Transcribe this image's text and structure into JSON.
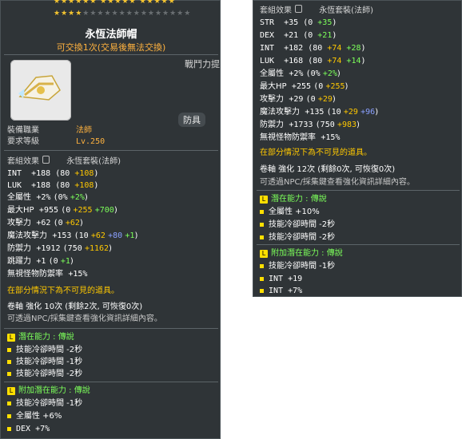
{
  "left": {
    "stars_top": "★★★★★★ ★★★★★ ★★★★★",
    "stars_row_on": "★★★★",
    "stars_row_off": "★★★★★★★★★★★★★★★",
    "item_name": "永恆法師帽",
    "trade_note": "可交換1次(交易後無法交換)",
    "side_label": "戰鬥力提",
    "tab_armor": "防具",
    "equip_job_label": "裝備職業",
    "equip_job_value": "法師",
    "req_level_label": "要求等級",
    "req_level_value": "Lv.250",
    "set_label": "套組效果",
    "set_name": "永恆套裝(法師)",
    "stats": {
      "int": {
        "label": "INT",
        "total": "+188",
        "base": "(80",
        "bonus": "+108",
        "end": ")"
      },
      "luk": {
        "label": "LUK",
        "total": "+188",
        "base": "(80",
        "bonus": "+108",
        "end": ")"
      },
      "all": {
        "label": "全屬性",
        "total": "+2%",
        "base": "(0%",
        "bonus": "+2%",
        "end": ")"
      },
      "hp": {
        "label": "最大HP",
        "total": "+955",
        "base": "(0",
        "b1": "+255",
        "b2": "+700",
        "end": ")"
      },
      "atk": {
        "label": "攻擊力",
        "total": "+62",
        "base": "(0",
        "bonus": "+62",
        "end": ")"
      },
      "matk": {
        "label": "魔法攻擊力",
        "total": "+153",
        "base": "(10",
        "b1": "+62",
        "b2": "+80",
        "b3": "+1",
        "end": ")"
      },
      "def": {
        "label": "防禦力",
        "total": "+1912",
        "base": "(750",
        "bonus": "+1162",
        "end": ")"
      },
      "jump": {
        "label": "跳躍力",
        "total": "+1",
        "base": "(0",
        "bonus": "+1",
        "end": ")"
      },
      "ied": {
        "label": "無視怪物防禦率",
        "total": "+15%"
      }
    },
    "partial_note": "在部分情況下為不可見的道具。",
    "scroll_line": "卷軸 強化 10次 (剩餘2次, 可恢復0次)",
    "npc_note": "可透過NPC/採集鍵查看強化資訊詳細內容。",
    "potential_label": "潛在能力 : 傳說",
    "potential": [
      "技能冷卻時間 -2秒",
      "技能冷卻時間 -1秒",
      "技能冷卻時間 -2秒"
    ],
    "add_potential_label": "附加潛在能力 : 傳說",
    "add_potential": [
      "技能冷卻時間 -1秒",
      "全屬性 +6%",
      "DEX +7%"
    ]
  },
  "right": {
    "set_label": "套組效果",
    "set_name": "永恆套裝(法師)",
    "stats": {
      "str": {
        "label": "STR",
        "total": "+35",
        "base": "(0",
        "bonus": "+35",
        "end": ")"
      },
      "dex": {
        "label": "DEX",
        "total": "+21",
        "base": "(0",
        "bonus": "+21",
        "end": ")"
      },
      "int": {
        "label": "INT",
        "total": "+182",
        "base": "(80",
        "b1": "+74",
        "b2": "+28",
        "end": ")"
      },
      "luk": {
        "label": "LUK",
        "total": "+168",
        "base": "(80",
        "b1": "+74",
        "b2": "+14",
        "end": ")"
      },
      "all": {
        "label": "全屬性",
        "total": "+2%",
        "base": "(0%",
        "bonus": "+2%",
        "end": ")"
      },
      "hp": {
        "label": "最大HP",
        "total": "+255",
        "base": "(0",
        "bonus": "+255",
        "end": ")"
      },
      "atk": {
        "label": "攻擊力",
        "total": "+29",
        "base": "(0",
        "bonus": "+29",
        "end": ")"
      },
      "matk": {
        "label": "魔法攻擊力",
        "total": "+135",
        "base": "(10",
        "b1": "+29",
        "b2": "+96",
        "end": ")"
      },
      "def": {
        "label": "防禦力",
        "total": "+1733",
        "base": "(750",
        "bonus": "+983",
        "end": ")"
      },
      "ied": {
        "label": "無視怪物防禦率",
        "total": "+15%"
      }
    },
    "partial_note": "在部分情況下為不可見的道具。",
    "scroll_line": "卷軸 強化 12次 (剩餘0次, 可恢復0次)",
    "npc_note": "可透過NPC/採集鍵查看強化資訊詳細內容。",
    "potential_label": "潛在能力 : 傳說",
    "potential": [
      "全屬性 +10%",
      "技能冷卻時間 -2秒",
      "技能冷卻時間 -2秒"
    ],
    "add_potential_label": "附加潛在能力 : 傳說",
    "add_potential": [
      "技能冷卻時間 -1秒",
      "INT +19",
      "INT +7%"
    ]
  },
  "colors": {
    "panel_bg": "#2f3437",
    "orange": "#ffb23f",
    "yellow": "#ffc800",
    "green": "#7cff5a",
    "blue": "#8aa0ff"
  }
}
